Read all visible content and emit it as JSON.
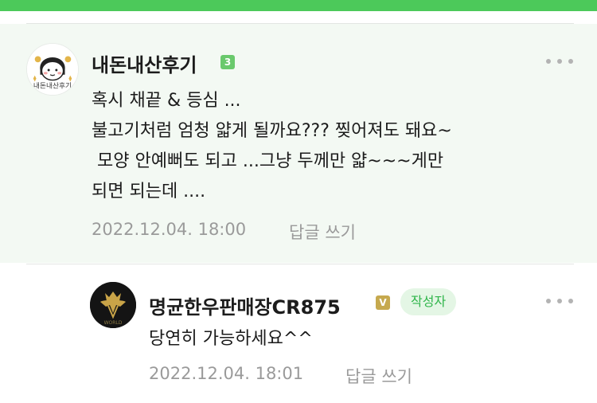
{
  "comments": [
    {
      "nickname": "내돈내산후기",
      "level": "3",
      "avatar_text": "내돈내산후기",
      "lines": [
        "혹시 채끝 & 등심 ...",
        "불고기처럼 엄청 얇게 될까요??? 찢어져도 돼요~",
        " 모양 안예뻐도 되고 ...그냥 두께만 얇~~~게만",
        "되면 되는데 ...."
      ],
      "date": "2022.12.04. 18:00",
      "reply_label": "답글 쓰기",
      "more_icon": "more-dots-icon"
    },
    {
      "nickname": "명균한우판매장CR875",
      "level": "V",
      "badge": "작성자",
      "avatar_text": "WORLD",
      "lines": [
        "당연히 가능하세요^^"
      ],
      "date": "2022.12.04. 18:01",
      "reply_label": "답글 쓰기",
      "more_icon": "more-dots-icon"
    }
  ],
  "colors": {
    "top_bar": "#4cc95a",
    "highlight_bg": "#f3f9f3",
    "meta_text": "#9a9a9a",
    "badge_text": "#2fb54a",
    "badge_bg": "#e4f6e5"
  }
}
